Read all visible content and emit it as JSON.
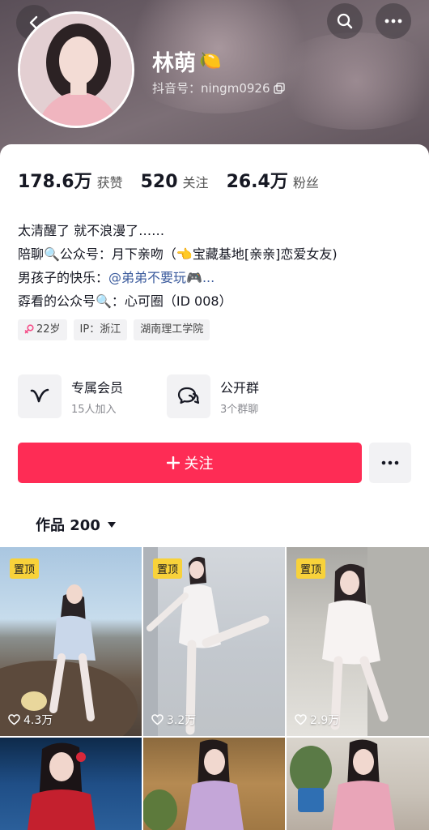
{
  "profile": {
    "name": "林萌",
    "name_emoji": "🍋",
    "douyin_id_label": "抖音号：ningm0926"
  },
  "stats": [
    {
      "num": "178.6万",
      "label": "获赞"
    },
    {
      "num": "520",
      "label": "关注"
    },
    {
      "num": "26.4万",
      "label": "粉丝"
    }
  ],
  "bio": {
    "line1": "太清醒了 就不浪漫了……",
    "line2": "陪聊🔍公众号：月下亲吻（👈宝藏基地[亲亲]恋爱女友)",
    "line3_prefix": "男孩子的快乐：",
    "line3_mention": "@弟弟不要玩🎮...",
    "line4": "孬看的公众号🔍：心可圈（ID 008）"
  },
  "tags": {
    "age": "22岁",
    "ip": "IP：浙江",
    "school": "湖南理工学院"
  },
  "features": {
    "member_title": "专属会员",
    "member_sub": "15人加入",
    "group_title": "公开群",
    "group_sub": "3个群聊"
  },
  "actions": {
    "follow_label": "关注"
  },
  "works": {
    "tab_label": "作品 200"
  },
  "grid": [
    {
      "pin": "置顶",
      "likes": "4.3万"
    },
    {
      "pin": "置顶",
      "likes": "3.2万"
    },
    {
      "pin": "置顶",
      "likes": "2.9万"
    }
  ],
  "colors": {
    "accent": "#fe2c55",
    "pin": "#f8d23a"
  }
}
